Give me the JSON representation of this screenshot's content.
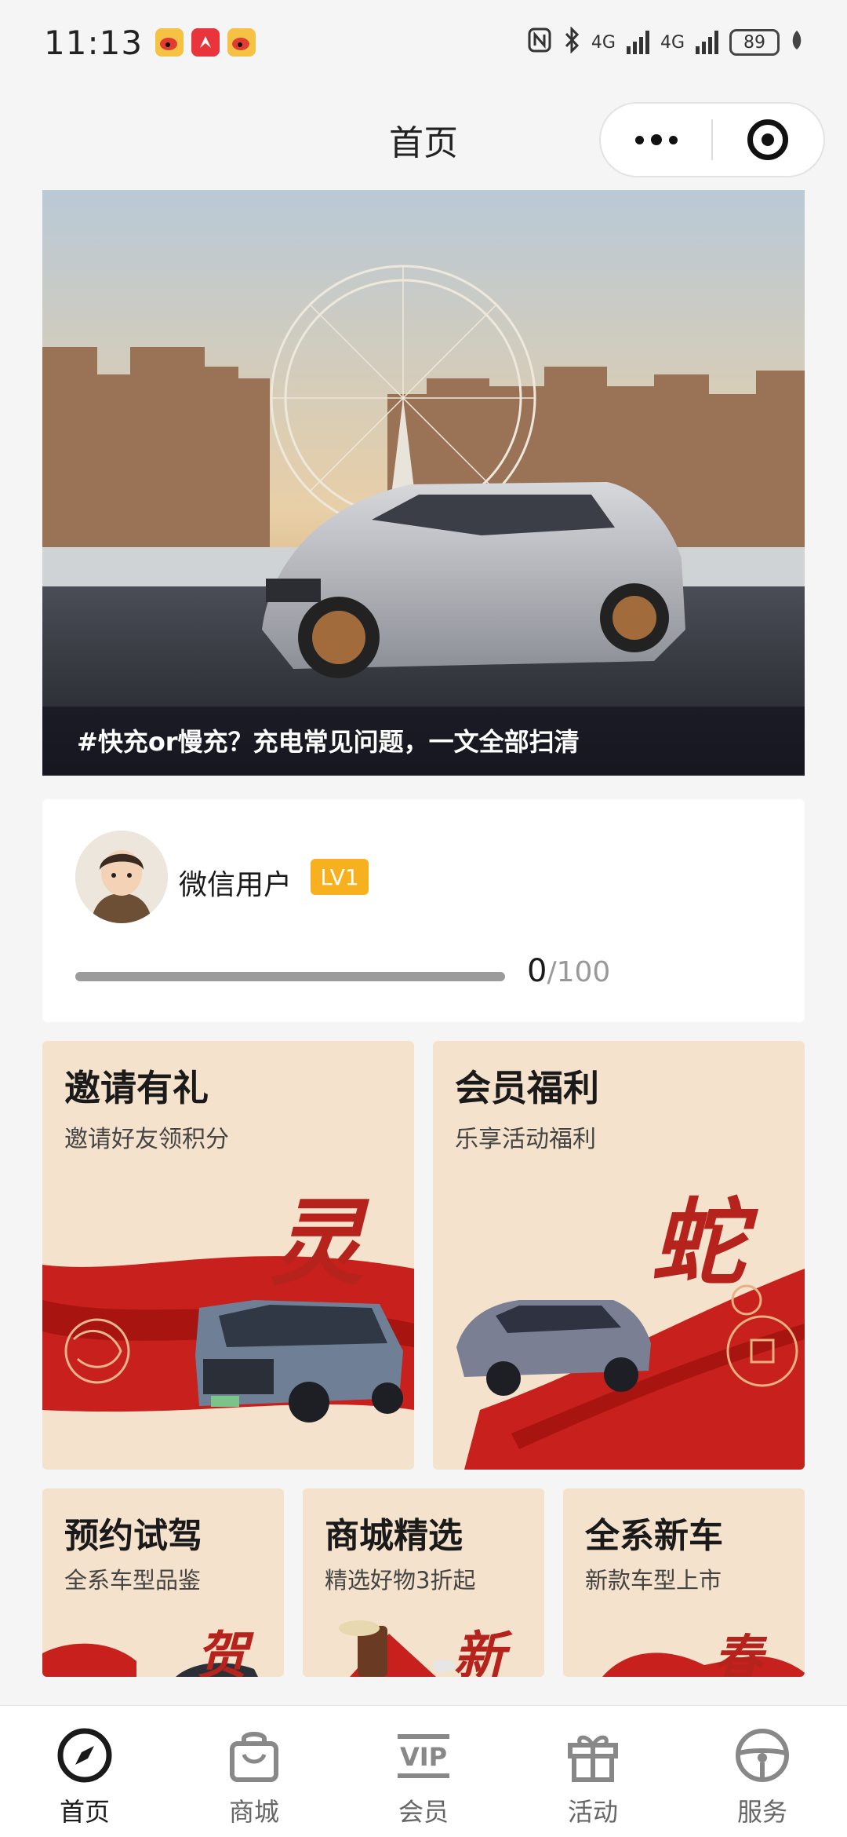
{
  "status_bar": {
    "time": "11:13",
    "network_1": "4G",
    "network_2": "4G",
    "battery": "89"
  },
  "nav": {
    "title": "首页"
  },
  "banner": {
    "caption": "#快充or慢充？充电常见问题，一文全部扫清"
  },
  "user": {
    "name": "微信用户",
    "level": "LV1",
    "points": "0",
    "points_total": "/100",
    "progress": 0
  },
  "cards": [
    {
      "title": "邀请有礼",
      "subtitle": "邀请好友领积分",
      "char": "灵"
    },
    {
      "title": "会员福利",
      "subtitle": "乐享活动福利",
      "char": "蛇"
    },
    {
      "title": "预约试驾",
      "subtitle": "全系车型品鉴",
      "char": "贺"
    },
    {
      "title": "商城精选",
      "subtitle": "精选好物3折起",
      "char": "新"
    },
    {
      "title": "全系新车",
      "subtitle": "新款车型上市",
      "char": "春"
    }
  ],
  "tabs": [
    {
      "label": "首页",
      "icon": "compass-icon",
      "active": true
    },
    {
      "label": "商城",
      "icon": "shopping-bag-icon",
      "active": false
    },
    {
      "label": "会员",
      "icon": "vip-icon",
      "active": false
    },
    {
      "label": "活动",
      "icon": "gift-icon",
      "active": false
    },
    {
      "label": "服务",
      "icon": "steering-wheel-icon",
      "active": false
    }
  ],
  "colors": {
    "accent": "#f7b11e",
    "card_bg": "#f4e2cc",
    "festive_red": "#c8201c"
  }
}
